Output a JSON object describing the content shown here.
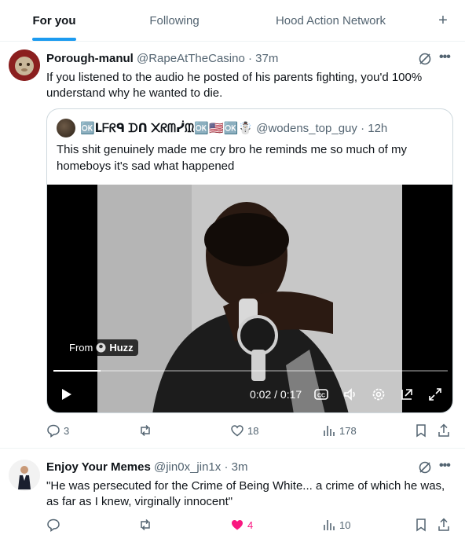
{
  "tabs": [
    {
      "label": "For you",
      "active": true
    },
    {
      "label": "Following",
      "active": false
    },
    {
      "label": "Hood Action Network",
      "active": false
    }
  ],
  "tab_add": "+",
  "posts": [
    {
      "name": "Porough-manul",
      "handle": "@RapeAtTheCasino",
      "time": "37m",
      "text": "If you listened to the audio he posted of his parents fighting, you'd 100% understand why he wanted to die.",
      "quote": {
        "name": "🆗ᒪᖴᖇᑫ ᗪᑎ ᙭ᖇᗰᓰᙢ🆗🇺🇸🆗☃️",
        "handle": "@wodens_top_guy",
        "time": "12h",
        "text": "This shit genuinely made me cry bro he reminds me so much of my homeboys it's sad what happened",
        "video": {
          "source_label": "From",
          "source_name": "Huzz",
          "time": "0:02 / 0:17",
          "progress": 0.12
        }
      },
      "stats": {
        "replies": "3",
        "reposts": "",
        "likes": "18",
        "views": "178"
      }
    },
    {
      "name": "Enjoy Your Memes",
      "handle": "@jin0x_jin1x",
      "time": "3m",
      "text": "\"He was persecuted for the Crime of Being White... a crime of which he was, as far as I knew, virginally innocent\"",
      "stats": {
        "replies": "",
        "reposts": "",
        "likes": "4",
        "views": "10"
      }
    }
  ],
  "colors": {
    "accent": "#1d9bf0",
    "like_pink": "#f91880",
    "muted": "#536471"
  }
}
